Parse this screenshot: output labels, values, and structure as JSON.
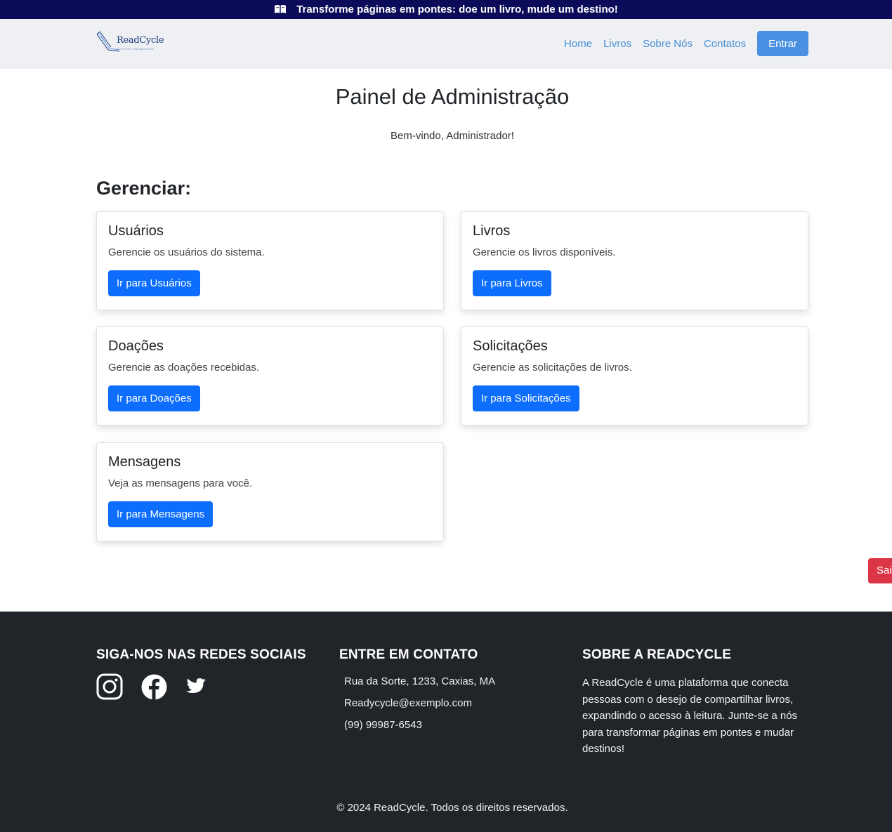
{
  "announcement": {
    "icon": "book-icon",
    "text": "Transforme páginas em pontes: doe um livro, mude um destino!"
  },
  "navbar": {
    "logo_text": "ReadCycle",
    "logo_subtitle": "CYCLING KNOWLEDGE",
    "links": [
      "Home",
      "Livros",
      "Sobre Nós",
      "Contatos"
    ],
    "login_label": "Entrar",
    "link_color": "#4a8fd4",
    "button_color": "#4a90e2"
  },
  "main": {
    "title": "Painel de Administração",
    "welcome": "Bem-vindo, Administrador!",
    "section_title": "Gerenciar:",
    "cards": [
      {
        "title": "Usuários",
        "description": "Gerencie os usuários do sistema.",
        "button": "Ir para Usuários"
      },
      {
        "title": "Livros",
        "description": "Gerencie os livros disponíveis.",
        "button": "Ir para Livros"
      },
      {
        "title": "Doações",
        "description": "Gerencie as doações recebidas.",
        "button": "Ir para Doações"
      },
      {
        "title": "Solicitações",
        "description": "Gerencie as solicitações de livros.",
        "button": "Ir para Solicitações"
      },
      {
        "title": "Mensagens",
        "description": "Veja as mensagens para você.",
        "button": "Ir para Mensagens"
      }
    ],
    "button_color": "#0d6efd"
  },
  "side_button": {
    "label": "Sair",
    "color": "#dc3545"
  },
  "footer": {
    "social_title": "SIGA-NOS NAS REDES SOCIAIS",
    "social_icons": [
      "instagram-icon",
      "facebook-icon",
      "twitter-icon"
    ],
    "contact_title": "ENTRE EM CONTATO",
    "address": "Rua da Sorte, 1233, Caxias, MA",
    "email": "Readycycle@exemplo.com",
    "phone": "(99) 99987-6543",
    "about_title": "SOBRE A READCYCLE",
    "about_text": "A ReadCycle é uma plataforma que conecta pessoas com o desejo de compartilhar livros, expandindo o acesso à leitura. Junte-se a nós para transformar páginas em pontes e mudar destinos!",
    "copyright": "© 2024 ReadCycle. Todos os direitos reservados.",
    "background": "#212529"
  }
}
